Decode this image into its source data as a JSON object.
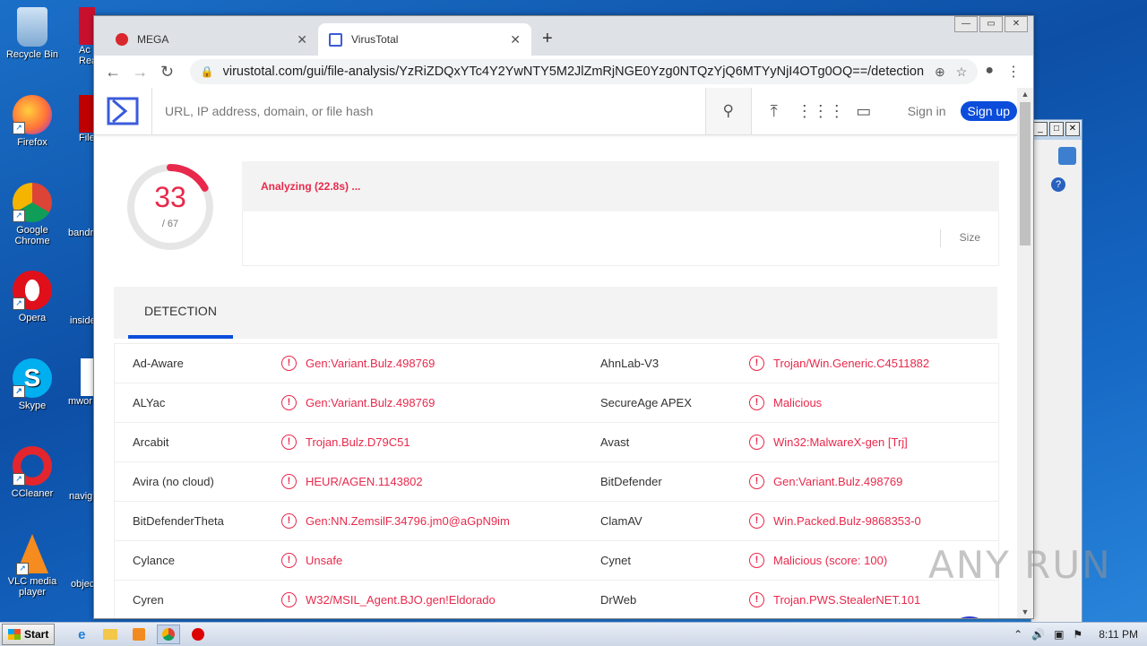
{
  "desktop": {
    "icons": [
      {
        "label": "Recycle Bin"
      },
      {
        "label": "Firefox"
      },
      {
        "label": "Google Chrome"
      },
      {
        "label": "Opera"
      },
      {
        "label": "Skype"
      },
      {
        "label": "CCleaner"
      },
      {
        "label": "VLC media player"
      }
    ],
    "partial_labels": [
      "Ac",
      "Rea",
      "FileZi",
      "bandr",
      "inside",
      "mwor",
      "navig",
      "objec"
    ]
  },
  "browser": {
    "tabs": [
      {
        "title": "MEGA",
        "favicon": "mega-icon",
        "color": "#d9272e"
      },
      {
        "title": "VirusTotal",
        "favicon": "virustotal-icon",
        "color": "#3b5bdb"
      }
    ],
    "url": "virustotal.com/gui/file-analysis/YzRiZDQxYTc4Y2YwNTY5M2JlZmRjNGE0Yzg0NTQzYjQ6MTYyNjI4OTg0OQ==/detection"
  },
  "vt": {
    "search_placeholder": "URL, IP address, domain, or file hash",
    "signin": "Sign in",
    "signup": "Sign up",
    "score": "33",
    "score_total": "/ 67",
    "score_fraction": 0.49,
    "status": "Analyzing (22.8s) ...",
    "size_label": "Size",
    "tab_detection": "DETECTION",
    "accent": "#e8294c",
    "brand": "#0b4dda",
    "rows": [
      {
        "e1": "Ad-Aware",
        "r1": "Gen:Variant.Bulz.498769",
        "e2": "AhnLab-V3",
        "r2": "Trojan/Win.Generic.C4511882"
      },
      {
        "e1": "ALYac",
        "r1": "Gen:Variant.Bulz.498769",
        "e2": "SecureAge APEX",
        "r2": "Malicious"
      },
      {
        "e1": "Arcabit",
        "r1": "Trojan.Bulz.D79C51",
        "e2": "Avast",
        "r2": "Win32:MalwareX-gen [Trj]"
      },
      {
        "e1": "Avira (no cloud)",
        "r1": "HEUR/AGEN.1143802",
        "e2": "BitDefender",
        "r2": "Gen:Variant.Bulz.498769"
      },
      {
        "e1": "BitDefenderTheta",
        "r1": "Gen:NN.ZemsilF.34796.jm0@aGpN9im",
        "e2": "ClamAV",
        "r2": "Win.Packed.Bulz-9868353-0"
      },
      {
        "e1": "Cylance",
        "r1": "Unsafe",
        "e2": "Cynet",
        "r2": "Malicious (score: 100)"
      },
      {
        "e1": "Cyren",
        "r1": "W32/MSIL_Agent.BJO.gen!Eldorado",
        "e2": "DrWeb",
        "r2": "Trojan.PWS.StealerNET.101"
      }
    ]
  },
  "watermark": "ANY RUN",
  "taskbar": {
    "start": "Start",
    "time": "8:11 PM"
  }
}
